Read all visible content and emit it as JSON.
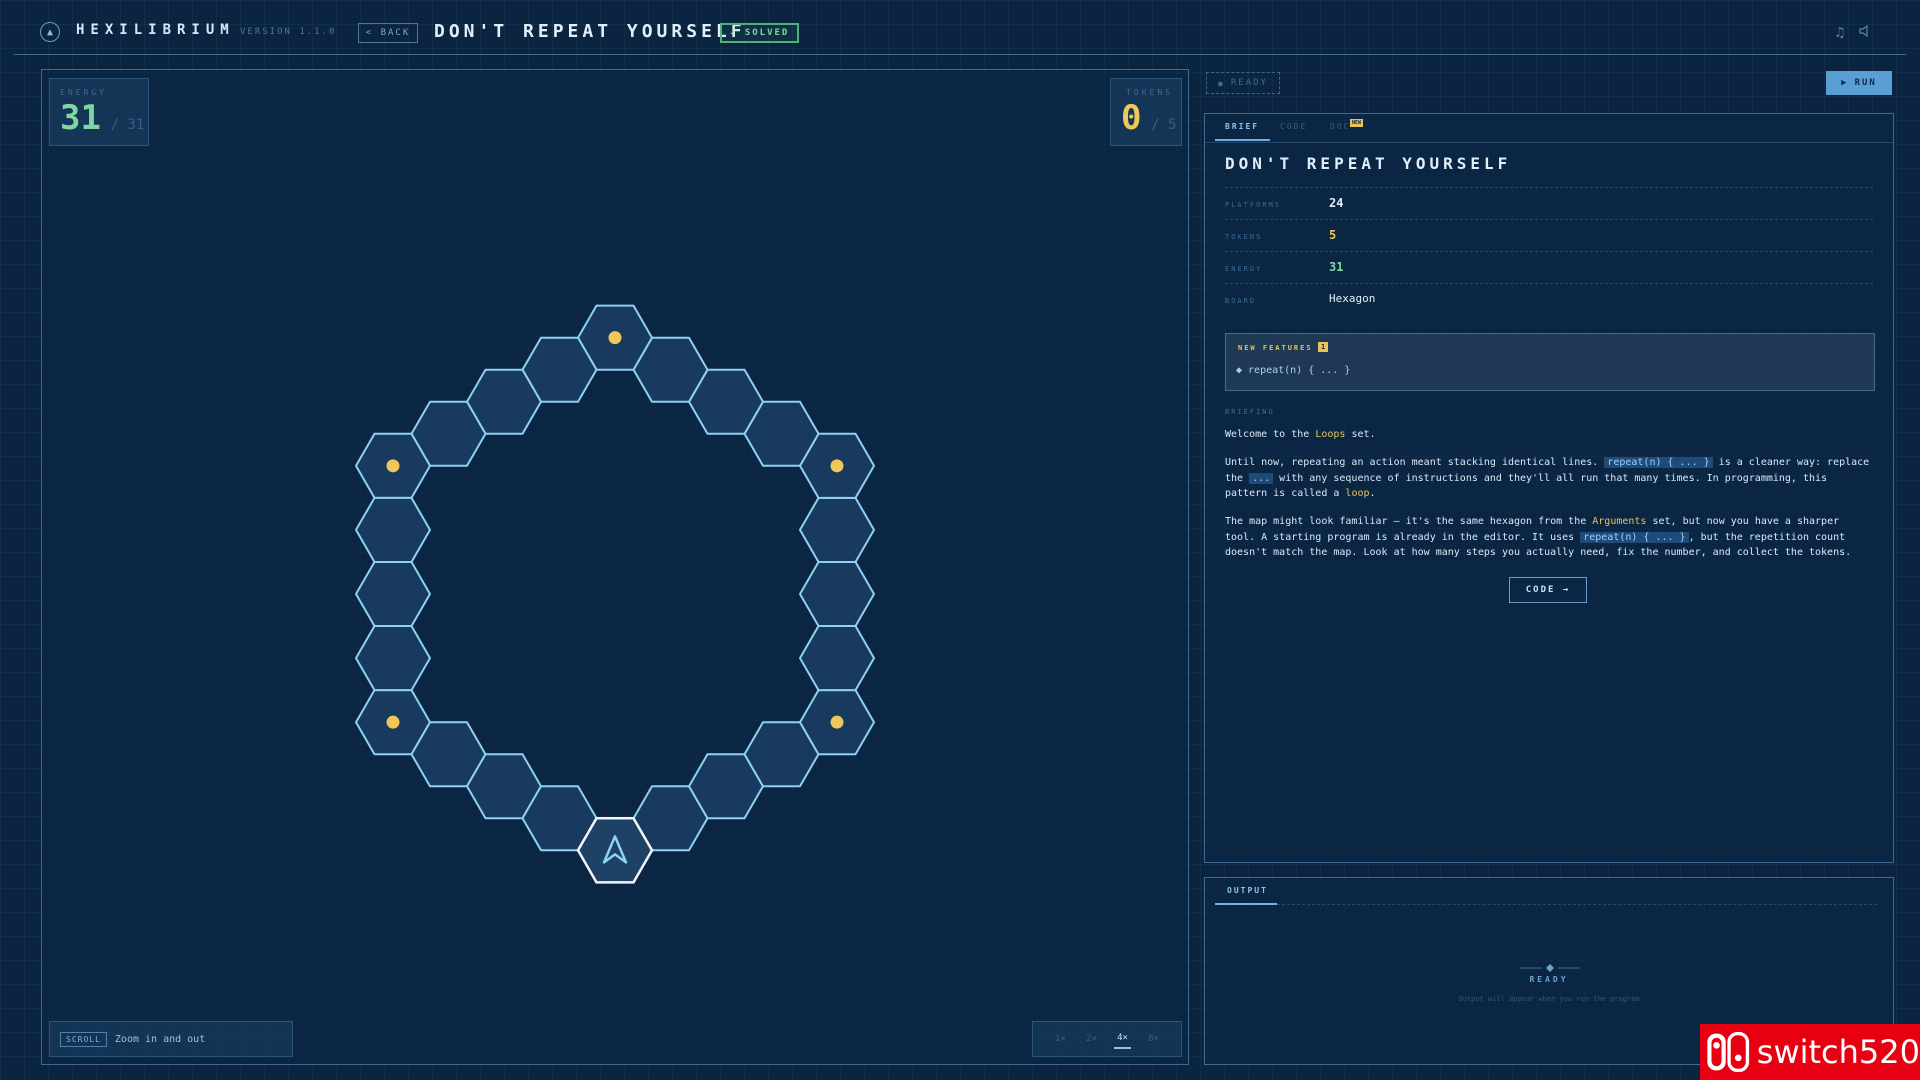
{
  "header": {
    "brand": "HEXILIBRIUM",
    "version": "VERSION 1.1.0",
    "back_label": "< BACK",
    "title": "DON'T REPEAT YOURSELF",
    "solved_label": "✓ SOLVED",
    "icons": [
      "music-icon",
      "sound-icon"
    ]
  },
  "board": {
    "energy": {
      "label": "ENERGY",
      "value": "31",
      "max": "/ 31"
    },
    "tokens": {
      "label": "TOKENS",
      "value": "0",
      "max": "/ 5"
    },
    "scroll_badge": "SCROLL",
    "scroll_text": "Zoom in and out",
    "speeds": [
      "1×",
      "2×",
      "4×",
      "8×"
    ],
    "active_speed": "4×"
  },
  "controls": {
    "ready_label": "READY",
    "run_label": "RUN"
  },
  "brief": {
    "tabs": [
      "BRIEF",
      "CODE",
      "DOC"
    ],
    "active_tab": "BRIEF",
    "tab_badge": "NEW",
    "title": "DON'T REPEAT YOURSELF",
    "rows": [
      {
        "key": "PLATFORMS",
        "value": "24"
      },
      {
        "key": "TOKENS",
        "value": "5"
      },
      {
        "key": "ENERGY",
        "value": "31"
      },
      {
        "key": "BOARD",
        "value": "Hexagon"
      }
    ],
    "new_features_label": "NEW FEATURES",
    "new_features_count": "1",
    "feature_item": "◆ repeat(n) { ... }",
    "briefing_label": "BRIEFING",
    "p1_a": "Welcome to the ",
    "p1_hl": "Loops",
    "p1_b": " set.",
    "p2_a": "Until now, repeating an action meant stacking identical lines. ",
    "p2_code1": "repeat(n) { ... }",
    "p2_b": " is a cleaner way: replace the ",
    "p2_code2": "...",
    "p2_c": " with any sequence of instructions and they'll all run that many times. In programming, this pattern is called a ",
    "p2_hl": "loop",
    "p2_d": ".",
    "p3_a": "The map might look familiar — it's the same hexagon from the ",
    "p3_hl": "Arguments",
    "p3_b": " set, but now you have a sharper tool. A starting program is already in the editor. It uses ",
    "p3_code": "repeat(n) { ... }",
    "p3_c": ", but the repetition count doesn't match the map. Look at how many steps you actually need, fix the number, and collect the tokens.",
    "code_button": "CODE →"
  },
  "output": {
    "tab": "OUTPUT",
    "status": "READY",
    "sub": "Output will appear when you run the program"
  },
  "watermark": "switch520",
  "colors": {
    "accent": "#6fb0e6",
    "energy": "#7fd6a4",
    "token": "#f0c75a",
    "hex_stroke": "#8fd0f5"
  }
}
